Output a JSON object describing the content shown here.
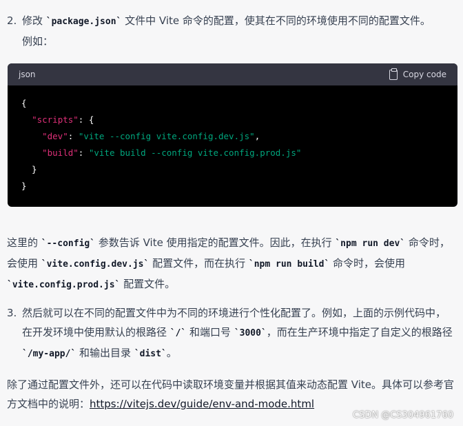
{
  "step2": {
    "number": "2.",
    "line1_a": "修改 ",
    "line1_code": "`package.json`",
    "line1_b": " 文件中 Vite 命令的配置，使其在不同的环境使用不同的配置文件。",
    "line2": "例如："
  },
  "codeblock": {
    "language": "json",
    "copy_label": "Copy code",
    "lines": {
      "l1": "{",
      "l2_indent": "  ",
      "l2_key": "\"scripts\"",
      "l2_rest": ": {",
      "l3_indent": "    ",
      "l3_key": "\"dev\"",
      "l3_sep": ": ",
      "l3_val": "\"vite --config vite.config.dev.js\"",
      "l3_end": ",",
      "l4_indent": "    ",
      "l4_key": "\"build\"",
      "l4_sep": ": ",
      "l4_val": "\"vite build --config vite.config.prod.js\"",
      "l5": "  }",
      "l6": "}"
    }
  },
  "explain": {
    "t1": "这里的 ",
    "c1": "`--config`",
    "t2": " 参数告诉 Vite 使用指定的配置文件。因此，在执行 ",
    "c2": "`npm run dev`",
    "t3": " 命令时，会使用 ",
    "c3": "`vite.config.dev.js`",
    "t4": " 配置文件，而在执行 ",
    "c4": "`npm run build`",
    "t5": " 命令时，会使用 ",
    "c5": "`vite.config.prod.js`",
    "t6": " 配置文件。"
  },
  "step3": {
    "number": "3.",
    "t1": "然后就可以在不同的配置文件中为不同的环境进行个性化配置了。例如，上面的示例代码中，在开发环境中使用默认的根路径 ",
    "c1": "`/`",
    "t2": " 和端口号 ",
    "c2": "`3000`",
    "t3": "，而在生产环境中指定了自定义的根路径 ",
    "c3": "`/my-app/`",
    "t4": " 和输出目录 ",
    "c4": "`dist`",
    "t5": "。"
  },
  "final": {
    "text": "除了通过配置文件外，还可以在代码中读取环境变量并根据其值来动态配置 Vite。具体可以参考官方文档中的说明：",
    "link": "https://vitejs.dev/guide/env-and-mode.html"
  },
  "watermark": "CSDN @CS304961760"
}
